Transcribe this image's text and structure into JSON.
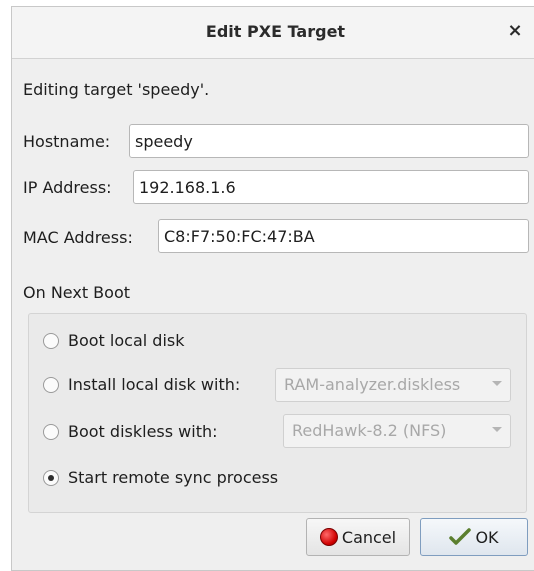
{
  "dialog": {
    "title": "Edit PXE Target",
    "close_glyph": "×",
    "editing_message": "Editing target 'speedy'."
  },
  "fields": {
    "hostname_label": "Hostname:",
    "hostname_value": "speedy",
    "ip_label": "IP Address:",
    "ip_value": "192.168.1.6",
    "mac_label": "MAC Address:",
    "mac_value": "C8:F7:50:FC:47:BA"
  },
  "next_boot": {
    "heading": "On Next Boot",
    "options": [
      {
        "label": "Boot local disk",
        "checked": false
      },
      {
        "label": "Install local disk with:",
        "checked": false,
        "select_value": "RAM-analyzer.diskless"
      },
      {
        "label": "Boot diskless with:",
        "checked": false,
        "select_value": "RedHawk-8.2 (NFS)"
      },
      {
        "label": "Start remote sync process",
        "checked": true
      }
    ]
  },
  "buttons": {
    "cancel_label": "Cancel",
    "ok_label": "OK"
  },
  "icons": {
    "cancel": "cancel-icon",
    "ok": "ok-check-icon",
    "close": "close-icon",
    "dropdown": "chevron-down-icon"
  }
}
